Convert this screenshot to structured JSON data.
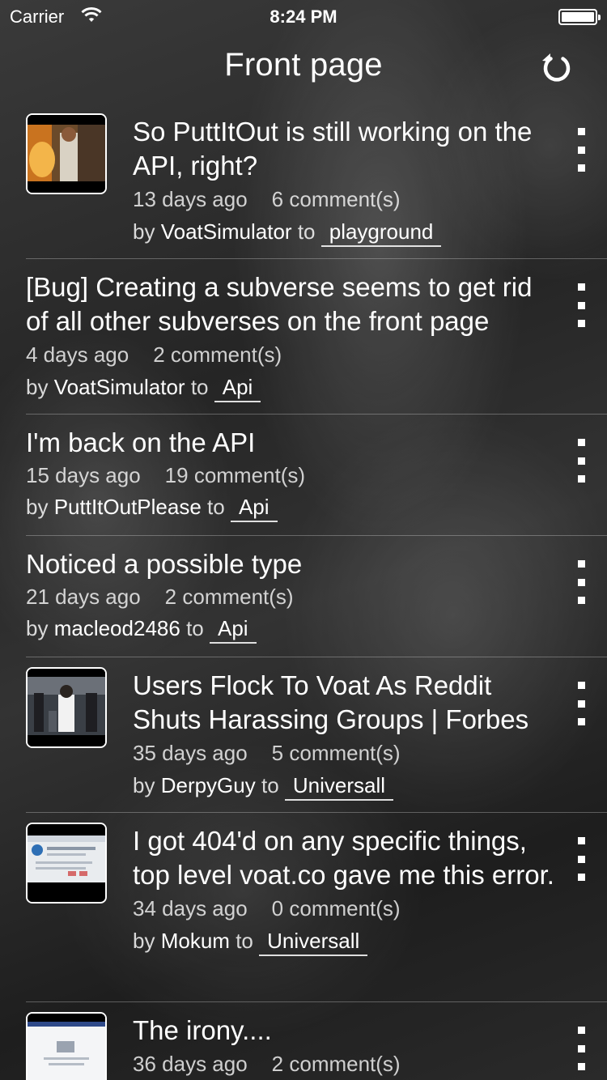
{
  "status_bar": {
    "carrier": "Carrier",
    "time": "8:24 PM",
    "battery_level": 1.0
  },
  "nav": {
    "title": "Front page",
    "refresh_icon": "refresh-icon"
  },
  "labels": {
    "by": "by",
    "to": "to"
  },
  "posts": [
    {
      "title": "So PuttItOut is still working on the API, right?",
      "age": "13 days ago",
      "comments": "6 comment(s)",
      "author": "VoatSimulator",
      "subverse": "playground",
      "has_thumbnail": true
    },
    {
      "title": "[Bug] Creating a subverse seems to get rid of all other subverses on the front page",
      "age": "4 days ago",
      "comments": "2 comment(s)",
      "author": "VoatSimulator",
      "subverse": "Api",
      "has_thumbnail": false
    },
    {
      "title": "I'm back on the API",
      "age": "15 days ago",
      "comments": "19 comment(s)",
      "author": "PuttItOutPlease",
      "subverse": "Api",
      "has_thumbnail": false
    },
    {
      "title": "Noticed a possible type",
      "age": "21 days ago",
      "comments": "2 comment(s)",
      "author": "macleod2486",
      "subverse": "Api",
      "has_thumbnail": false
    },
    {
      "title": "Users Flock To Voat As Reddit Shuts Harassing Groups | Forbes",
      "age": "35 days ago",
      "comments": "5 comment(s)",
      "author": "DerpyGuy",
      "subverse": "Universall",
      "has_thumbnail": true
    },
    {
      "title": "I got 404'd on any specific things, top level voat.co gave me this error.",
      "age": "34 days ago",
      "comments": "0 comment(s)",
      "author": "Mokum",
      "subverse": "Universall",
      "has_thumbnail": true
    },
    {
      "title": "The irony....",
      "age": "36 days ago",
      "comments": "2 comment(s)",
      "author": "",
      "subverse": "",
      "has_thumbnail": true
    }
  ]
}
